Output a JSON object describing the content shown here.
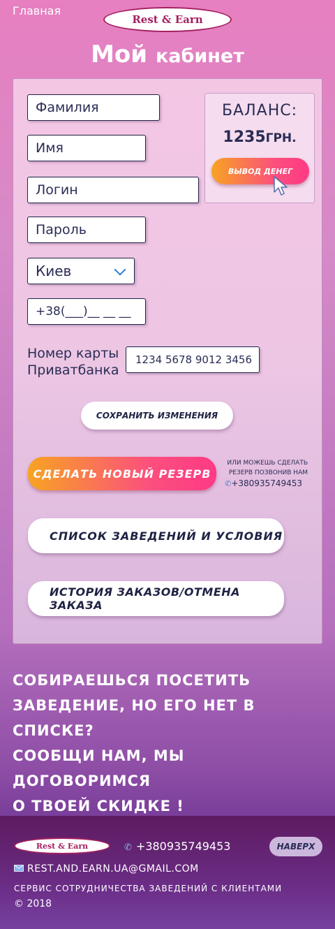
{
  "nav": {
    "home": "Главная"
  },
  "brand": {
    "logo_text": "Rest & Earn"
  },
  "page": {
    "title_big": "Мой",
    "title_small": "кабинет"
  },
  "form": {
    "surname_placeholder": "Фамилия",
    "name_placeholder": "Имя",
    "login_placeholder": "Логин",
    "password_placeholder": "Пароль",
    "city_selected": "Киев",
    "phone_mask": "+38(___)__ __ __",
    "card_label_line1": "Номер карты",
    "card_label_line2": "Приватбанка",
    "card_number": "1234 5678 9012 3456",
    "save_label": "СОХРАНИТЬ ИЗМЕНЕНИЯ"
  },
  "balance": {
    "title": "БАЛАНС:",
    "amount": "1235",
    "currency": "ГРН.",
    "withdraw_label": "ВЫВОД ДЕНЕГ"
  },
  "actions": {
    "reserve_label": "СДЕЛАТЬ НОВЫЙ РЕЗЕРВ",
    "reserve_note_line1": "ИЛИ МОЖЕШЬ СДЕЛАТЬ",
    "reserve_note_line2": "РЕЗЕРВ ПОЗВОНИВ НАМ",
    "reserve_phone": "+380935749453",
    "list_label": "СПИСОК ЗАВЕДЕНИЙ И УСЛОВИЯ",
    "history_label": "ИСТОРИЯ ЗАКАЗОВ/ОТМЕНА ЗАКАЗА"
  },
  "promo": {
    "line1": "СОБИРАЕШЬСЯ ПОСЕТИТЬ",
    "line2": "ЗАВЕДЕНИЕ, НО ЕГО НЕТ В СПИСКЕ?",
    "line3": "СООБЩИ НАМ, МЫ ДОГОВОРИМСЯ",
    "line4": "О ТВОЕЙ СКИДКЕ !"
  },
  "footer": {
    "phone": "+380935749453",
    "back_to_top": "НАВЕРХ",
    "email": "REST.AND.EARN.UA@GMAIL.COM",
    "description": "СЕРВИС СОТРУДНИЧЕСТВА ЗАВЕДЕНИЙ С КЛИЕНТАМИ",
    "copyright": "© 2018"
  },
  "colors": {
    "brand": "#a3205f",
    "accent_orange": "#f8a322",
    "accent_pink": "#ff3a85",
    "text_dark": "#1f2244"
  },
  "icons": {
    "phone": "phone-icon",
    "email": "email-icon",
    "dropdown": "chevron-down-icon",
    "cursor": "cursor-icon"
  }
}
